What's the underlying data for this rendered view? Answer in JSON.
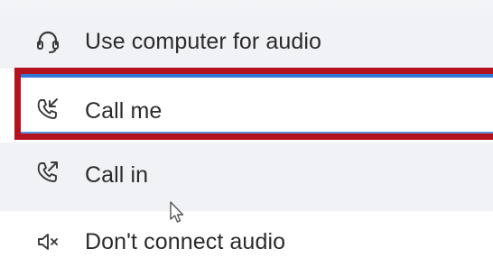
{
  "audio_menu": {
    "items": [
      {
        "label": "Use computer for audio",
        "icon": "headset-icon"
      },
      {
        "label": "Call me",
        "icon": "phone-incoming-icon",
        "selected": true
      },
      {
        "label": "Call in",
        "icon": "phone-outgoing-icon"
      },
      {
        "label": "Don't connect audio",
        "icon": "speaker-muted-icon"
      }
    ]
  },
  "colors": {
    "highlight_border": "#b3131e",
    "selection_accent": "#2f78d4",
    "check_fill": "#2f86d9"
  },
  "cursor_icon": "mouse-pointer-icon",
  "check_icon": "checkmark-icon"
}
